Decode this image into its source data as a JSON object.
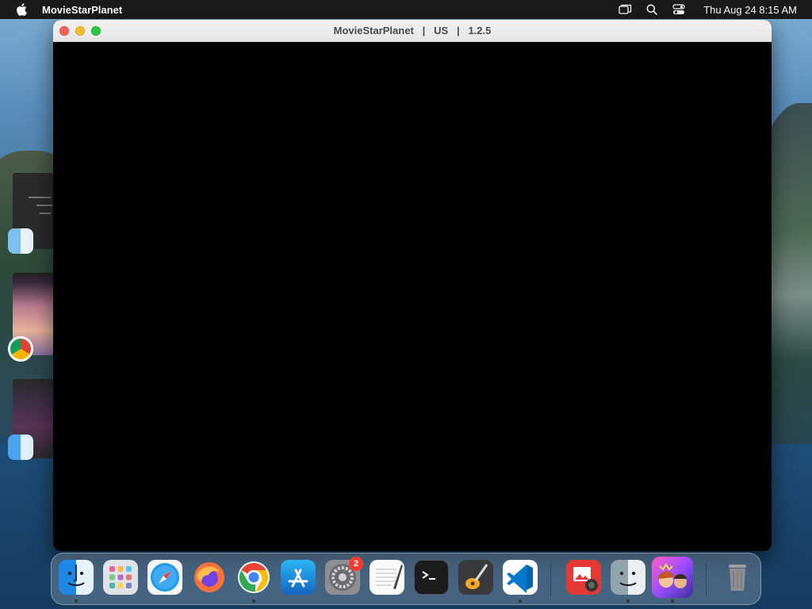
{
  "menubar": {
    "app_name": "MovieStarPlanet",
    "clock": "Thu Aug 24  8:15 AM",
    "icons": [
      "apple-icon",
      "screen-mirroring-icon",
      "spotlight-search-icon",
      "control-center-icon"
    ]
  },
  "window": {
    "title": "MovieStarPlanet   |   US   |   1.2.5"
  },
  "stage_manager": {
    "groups": [
      {
        "app_icon": "finder-icon"
      },
      {
        "app_icon": "chrome-icon"
      },
      {
        "app_icon": "finder-icon"
      }
    ]
  },
  "dock": {
    "items": [
      {
        "name": "Finder",
        "icon": "finder-icon",
        "running": true
      },
      {
        "name": "Launchpad",
        "icon": "launchpad-icon",
        "running": false
      },
      {
        "name": "Safari",
        "icon": "safari-icon",
        "running": false
      },
      {
        "name": "Firefox",
        "icon": "firefox-icon",
        "running": false
      },
      {
        "name": "Google Chrome",
        "icon": "chrome-icon",
        "running": true
      },
      {
        "name": "App Store",
        "icon": "app-store-icon",
        "running": false
      },
      {
        "name": "System Preferences",
        "icon": "system-preferences-icon",
        "running": false,
        "badge": "2"
      },
      {
        "name": "TextEdit",
        "icon": "textedit-icon",
        "running": false
      },
      {
        "name": "Terminal",
        "icon": "terminal-icon",
        "running": false
      },
      {
        "name": "GarageBand",
        "icon": "garageband-icon",
        "running": false
      },
      {
        "name": "Visual Studio Code",
        "icon": "vscode-icon",
        "running": true
      },
      {
        "name": "Photo Booth",
        "icon": "photo-booth-icon",
        "running": false
      },
      {
        "name": "Finder",
        "icon": "finder-icon",
        "running": true
      },
      {
        "name": "MovieStarPlanet",
        "icon": "moviestarplanet-icon",
        "running": true
      },
      {
        "name": "Trash",
        "icon": "trash-icon",
        "running": false
      }
    ]
  }
}
